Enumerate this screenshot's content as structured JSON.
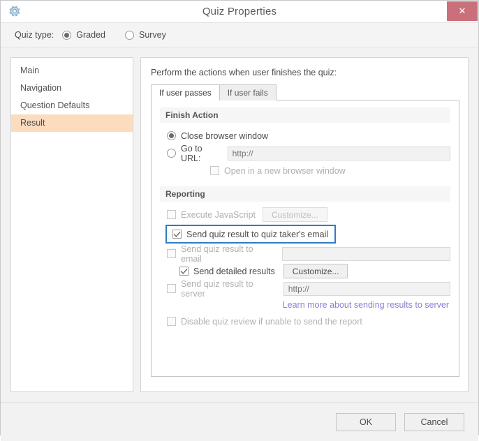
{
  "window": {
    "title": "Quiz Properties",
    "gear_icon": "gear-icon",
    "close_label": "✕"
  },
  "quiz_type": {
    "label": "Quiz type:",
    "options": [
      {
        "label": "Graded",
        "selected": true
      },
      {
        "label": "Survey",
        "selected": false
      }
    ]
  },
  "sidebar": {
    "items": [
      {
        "label": "Main",
        "selected": false
      },
      {
        "label": "Navigation",
        "selected": false
      },
      {
        "label": "Question Defaults",
        "selected": false
      },
      {
        "label": "Result",
        "selected": true
      }
    ]
  },
  "content": {
    "intro": "Perform the actions when user finishes the quiz:",
    "tabs": [
      {
        "label": "If user passes",
        "active": true
      },
      {
        "label": "If user fails",
        "active": false
      }
    ],
    "finish_action": {
      "header": "Finish Action",
      "close_browser": {
        "label": "Close browser window",
        "selected": true
      },
      "go_to_url": {
        "label": "Go to URL:",
        "selected": false,
        "placeholder": "http://",
        "value": ""
      },
      "open_new_window": {
        "label": "Open in a new browser window",
        "checked": false,
        "disabled": true
      }
    },
    "reporting": {
      "header": "Reporting",
      "execute_js": {
        "label": "Execute JavaScript",
        "checked": false,
        "disabled": true
      },
      "execute_js_button": {
        "label": "Customize...",
        "disabled": true
      },
      "send_taker_email": {
        "label": "Send quiz result to quiz taker's email",
        "checked": true,
        "highlighted": true
      },
      "send_to_email": {
        "label": "Send quiz result to email",
        "checked": false,
        "disabled": true,
        "placeholder": "",
        "value": ""
      },
      "send_detailed": {
        "label": "Send detailed results",
        "checked": true
      },
      "send_detailed_button": {
        "label": "Customize...",
        "disabled": false
      },
      "send_to_server": {
        "label": "Send quiz result to server",
        "checked": false,
        "disabled": true,
        "placeholder": "http://",
        "value": ""
      },
      "learn_more_link": "Learn more about sending results to server",
      "disable_review": {
        "label": "Disable quiz review if unable to send the report",
        "checked": false,
        "disabled": true
      }
    }
  },
  "footer": {
    "ok_label": "OK",
    "cancel_label": "Cancel"
  },
  "colors": {
    "accent_highlight": "#2e7cc4",
    "selected_sidebar": "#fbdcbf",
    "close_button": "#c9707a",
    "link": "#8a7fd4",
    "gear": "#8fb3cf"
  }
}
